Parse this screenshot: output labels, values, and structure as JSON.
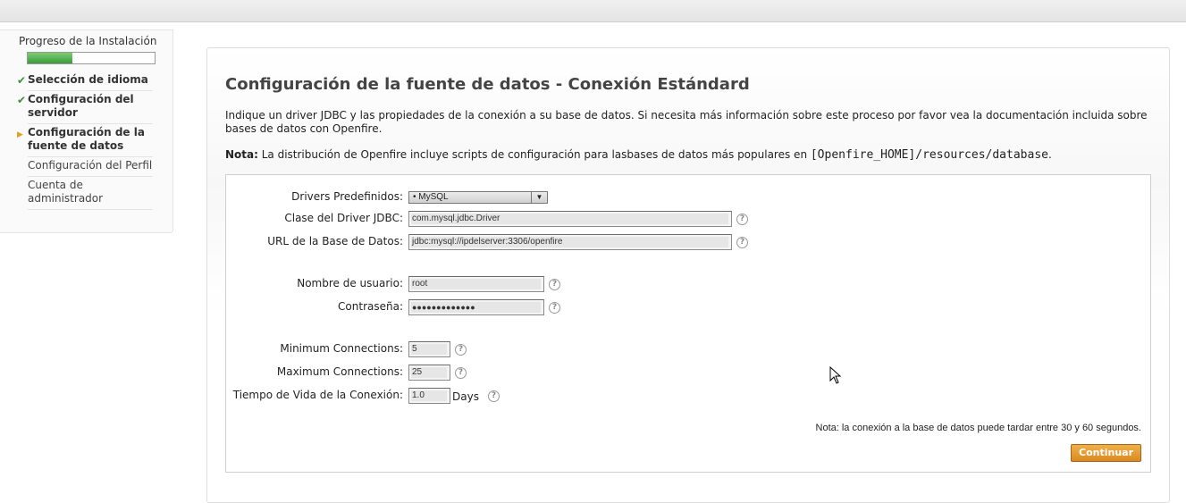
{
  "sidebar": {
    "title": "Progreso de la Instalación",
    "progress_percent": 35,
    "steps": [
      {
        "label": "Selección de idioma",
        "state": "done"
      },
      {
        "label": "Configuración del servidor",
        "state": "done"
      },
      {
        "label": "Configuración de la fuente de datos",
        "state": "current"
      },
      {
        "label": "Configuración del Perfil",
        "state": "pending"
      },
      {
        "label": "Cuenta de administrador",
        "state": "pending"
      }
    ]
  },
  "main": {
    "title": "Configuración de la fuente de datos - Conexión Estándard",
    "intro": "Indique un driver JDBC y las propiedades de la conexión a su base de datos. Si necesita más información sobre este proceso por favor vea la documentación incluida sobre bases de datos con Openfire.",
    "note_label": "Nota:",
    "note_text": " La distribución de Openfire incluye scripts de configuración para lasbases de datos más populares en ",
    "note_path": "[Openfire_HOME]/resources/database",
    "note_end": "."
  },
  "form": {
    "drivers_label": "Drivers Predefinidos:",
    "drivers_value": "• MySQL",
    "driver_class_label": "Clase del Driver JDBC:",
    "driver_class_value": "com.mysql.jdbc.Driver",
    "url_label": "URL de la Base de Datos:",
    "url_value": "jdbc:mysql://ipdelserver:3306/openfire",
    "username_label": "Nombre de usuario:",
    "username_value": "root",
    "password_label": "Contraseña:",
    "password_value": "●●●●●●●●●●●●●",
    "min_conn_label": "Minimum Connections:",
    "min_conn_value": "5",
    "max_conn_label": "Maximum Connections:",
    "max_conn_value": "25",
    "lifetime_label": "Tiempo de Vida de la Conexión:",
    "lifetime_value": "1.0",
    "lifetime_unit": "Days",
    "help_glyph": "?",
    "footnote": "Nota: la conexión a la base de datos puede tardar entre 30 y 60 segundos.",
    "continue_label": "Continuar"
  },
  "colors": {
    "accent": "#d98a1e",
    "progress": "#3a9b3a",
    "check": "#3d8f3d"
  }
}
